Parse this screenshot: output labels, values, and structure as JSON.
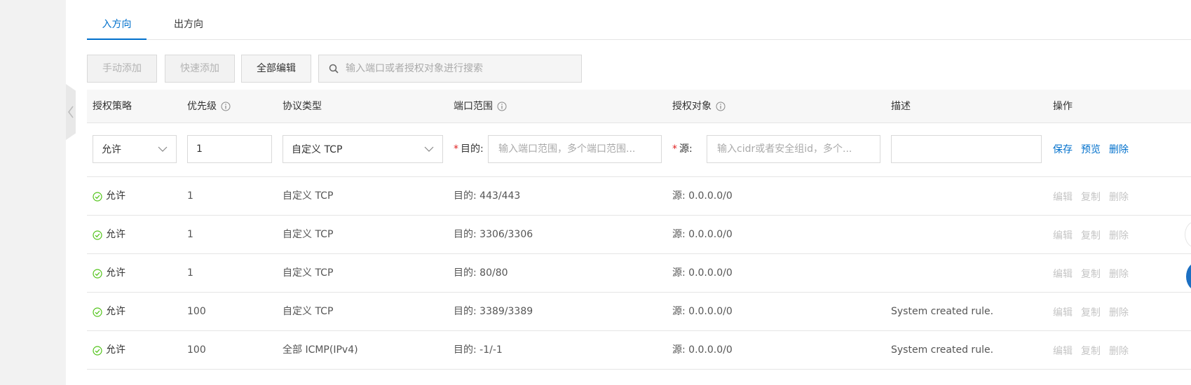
{
  "tabs": [
    {
      "label": "入方向",
      "active": true
    },
    {
      "label": "出方向",
      "active": false
    }
  ],
  "toolbar": {
    "manual_add": "手动添加",
    "quick_add": "快速添加",
    "edit_all": "全部编辑",
    "search_placeholder": "输入端口或者授权对象进行搜索",
    "search_icon": "search-icon"
  },
  "table": {
    "headers": {
      "policy": "授权策略",
      "priority": "优先级",
      "protocol": "协议类型",
      "port_range": "端口范围",
      "auth_object": "授权对象",
      "description": "描述",
      "actions": "操作"
    },
    "edit_row": {
      "policy_value": "允许",
      "priority_value": "1",
      "protocol_value": "自定义 TCP",
      "dest_label": "目的:",
      "port_placeholder": "输入端口范围，多个端口范围...",
      "src_label": "源:",
      "src_placeholder": "输入cidr或者安全组id，多个...",
      "description_value": "",
      "save": "保存",
      "preview": "预览",
      "delete": "删除"
    },
    "rows": [
      {
        "policy": "允许",
        "priority": "1",
        "protocol": "自定义 TCP",
        "port": "目的: 443/443",
        "source": "源: 0.0.0.0/0",
        "description": ""
      },
      {
        "policy": "允许",
        "priority": "1",
        "protocol": "自定义 TCP",
        "port": "目的: 3306/3306",
        "source": "源: 0.0.0.0/0",
        "description": ""
      },
      {
        "policy": "允许",
        "priority": "1",
        "protocol": "自定义 TCP",
        "port": "目的: 80/80",
        "source": "源: 0.0.0.0/0",
        "description": ""
      },
      {
        "policy": "允许",
        "priority": "100",
        "protocol": "自定义 TCP",
        "port": "目的: 3389/3389",
        "source": "源: 0.0.0.0/0",
        "description": "System created rule."
      },
      {
        "policy": "允许",
        "priority": "100",
        "protocol": "全部 ICMP(IPv4)",
        "port": "目的: -1/-1",
        "source": "源: 0.0.0.0/0",
        "description": "System created rule."
      }
    ],
    "row_actions": {
      "edit": "编辑",
      "copy": "复制",
      "delete": "删除"
    }
  },
  "colors": {
    "accent": "#0070cc",
    "success": "#52c41a",
    "required": "#e02020"
  }
}
